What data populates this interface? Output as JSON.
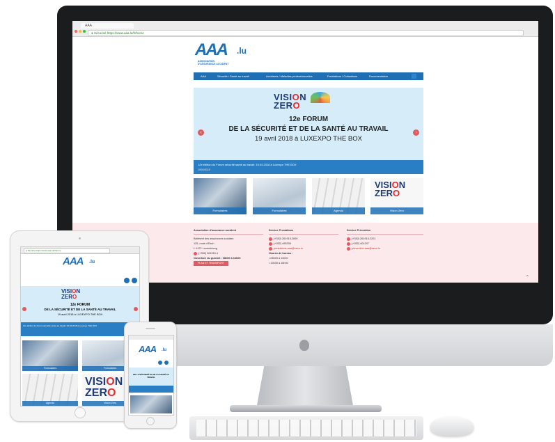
{
  "browser": {
    "tab_title": "AAA",
    "url": "● Sécurisé https://www.aaa.lu/fr/home"
  },
  "site": {
    "logo_main": "AAA",
    "logo_suffix": ".lu",
    "logo_subtitle_1": "ASSOCIATION",
    "logo_subtitle_2": "D'ASSURANCE ACCIDENT",
    "nav": [
      "AAA",
      "Sécurité / Santé au travail",
      "Accidents / Maladies professionnelles",
      "Prestations / Cotisations",
      "Documentation"
    ]
  },
  "banner": {
    "vision_1": "VISI",
    "vision_o": "O",
    "vision_2": "N",
    "zero_1": "ZER",
    "zero_o": "O",
    "line1": "12e FORUM",
    "line2": "DE LA SÉCURITÉ ET DE LA SANTÉ AU TRAVAIL",
    "line3": "19 avril 2018 à LUXEXPO THE BOX",
    "caption": "12e édition du Forum sécurité santé au travail: 19.04.2018 à Luxexpo THE BOX",
    "date": "19/04/2018",
    "prev": "‹",
    "next": "›"
  },
  "tiles": [
    "Formulaires",
    "Formulaires",
    "Agenda",
    "Vision Zero"
  ],
  "footer": {
    "col1": {
      "title": "Association d'assurance accident",
      "l1": "Bâtiment des assurances sociales",
      "l2": "125, route d'Esch",
      "l3": "L-1471 Luxembourg",
      "phone": "(+352) 261915-1",
      "hours": "Ouverture du guichet : 08h00 à 16h00",
      "button": "PLAN ET TRANSPORT"
    },
    "col2": {
      "title": "Service Prestations",
      "phone": "(+352) 261915-2690",
      "fax": "(+352) 495335",
      "email": "prestations.aaa@secu.lu",
      "hours_title": "Heures de bureau :",
      "h1": "• 08h00 à 11h30",
      "h2": "• 13h30 à 16h00"
    },
    "col3": {
      "title": "Service Prévention",
      "phone": "(+352) 261915-2201",
      "fax": "(+352) 401247",
      "email": "prevention.aaa@secu.lu"
    }
  },
  "ipad": {
    "banner_line1": "12e FORUM",
    "banner_line2": "DE LA SÉCURITÉ ET DE LA SANTÉ AU TRAVAIL",
    "banner_line3": "19 avril 2018 à LUXEXPO THE BOX",
    "tiles": [
      "Formulaires",
      "Formulaires",
      "Agenda",
      "Vision Zero"
    ]
  },
  "colors": {
    "brand": "#1f6fb5",
    "accent": "#e05b61",
    "banner_bg": "#d6ecf8",
    "footer_bg": "#fbe9ec"
  },
  "icons": [
    "search-icon",
    "chevron-left-icon",
    "chevron-right-icon",
    "phone-icon",
    "fax-icon",
    "mail-icon",
    "chevron-up-icon"
  ]
}
